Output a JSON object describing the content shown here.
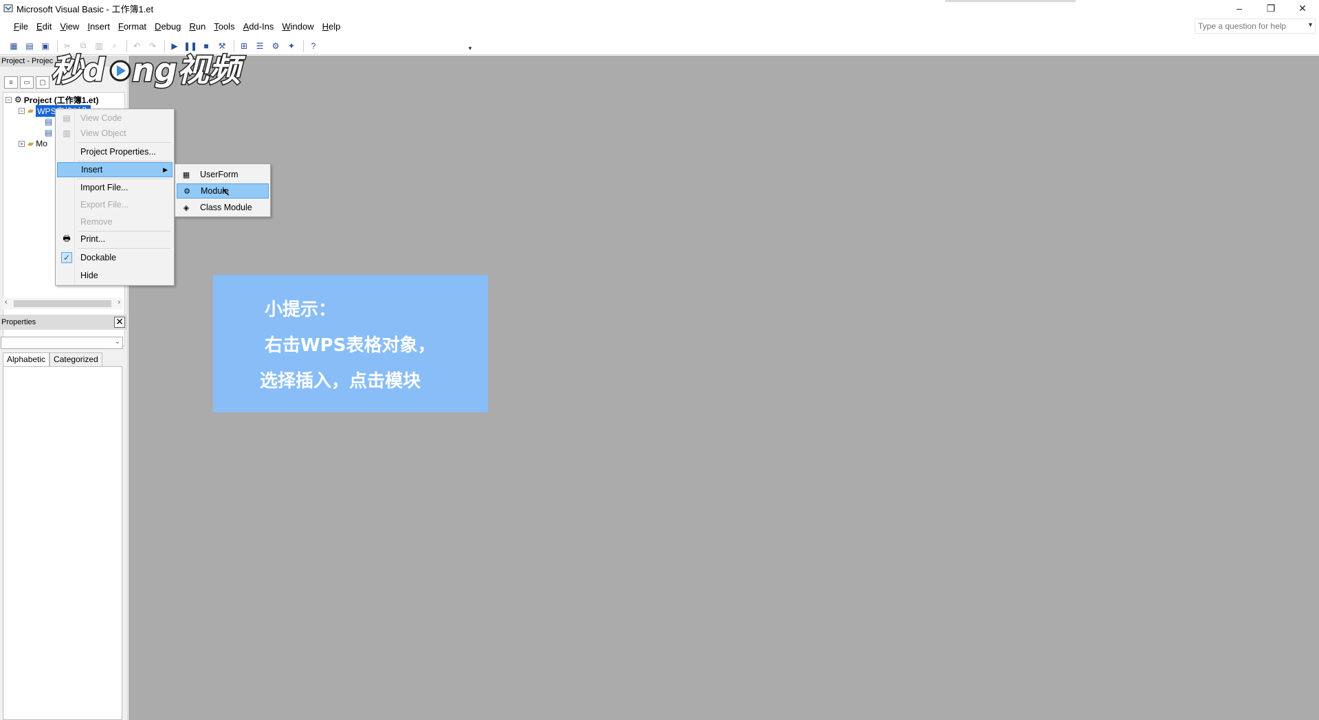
{
  "window": {
    "title": "Microsoft Visual Basic - 工作簿1.et",
    "controls": {
      "minimize": "–",
      "restore": "❐",
      "close": "✕"
    }
  },
  "menubar": {
    "items": [
      "File",
      "Edit",
      "View",
      "Insert",
      "Format",
      "Debug",
      "Run",
      "Tools",
      "Add-Ins",
      "Window",
      "Help"
    ]
  },
  "help_box": {
    "placeholder": "Type a question for help"
  },
  "project_panel": {
    "header": "Project - Projec",
    "tree": {
      "root": "Project (工作簿1.et)",
      "child_selected": "WPS表格对象",
      "folder_modules": "Mo"
    }
  },
  "properties_panel": {
    "header": "Properties",
    "close_glyph": "✕",
    "tabs": [
      "Alphabetic",
      "Categorized"
    ],
    "active_tab": "Alphabetic"
  },
  "context_menu": {
    "items": [
      {
        "label": "View Code",
        "enabled": false,
        "icon": "code-icon"
      },
      {
        "label": "View Object",
        "enabled": false,
        "icon": "object-icon"
      },
      {
        "label": "Project Properties...",
        "enabled": true
      },
      {
        "label": "Insert",
        "enabled": true,
        "highlighted": true,
        "submenu": true
      },
      {
        "label": "Import File...",
        "enabled": true
      },
      {
        "label": "Export File...",
        "enabled": false
      },
      {
        "label": "Remove",
        "enabled": false
      },
      {
        "label": "Print...",
        "enabled": true,
        "icon": "printer-icon"
      },
      {
        "label": "Dockable",
        "enabled": true,
        "checked": true
      },
      {
        "label": "Hide",
        "enabled": true
      }
    ]
  },
  "insert_submenu": {
    "items": [
      {
        "label": "UserForm",
        "icon": "userform-icon"
      },
      {
        "label": "Module",
        "icon": "module-icon",
        "highlighted": true
      },
      {
        "label": "Class Module",
        "icon": "class-module-icon"
      }
    ]
  },
  "tip": {
    "line1": "小提示：",
    "line2": "右击WPS表格对象，",
    "line3": "选择插入，点击模块"
  },
  "watermark": {
    "text": "秒dong视频"
  },
  "colors": {
    "mdi_background": "#ababab",
    "highlight": "#91c9f7",
    "tip_background": "#88bdf7"
  }
}
